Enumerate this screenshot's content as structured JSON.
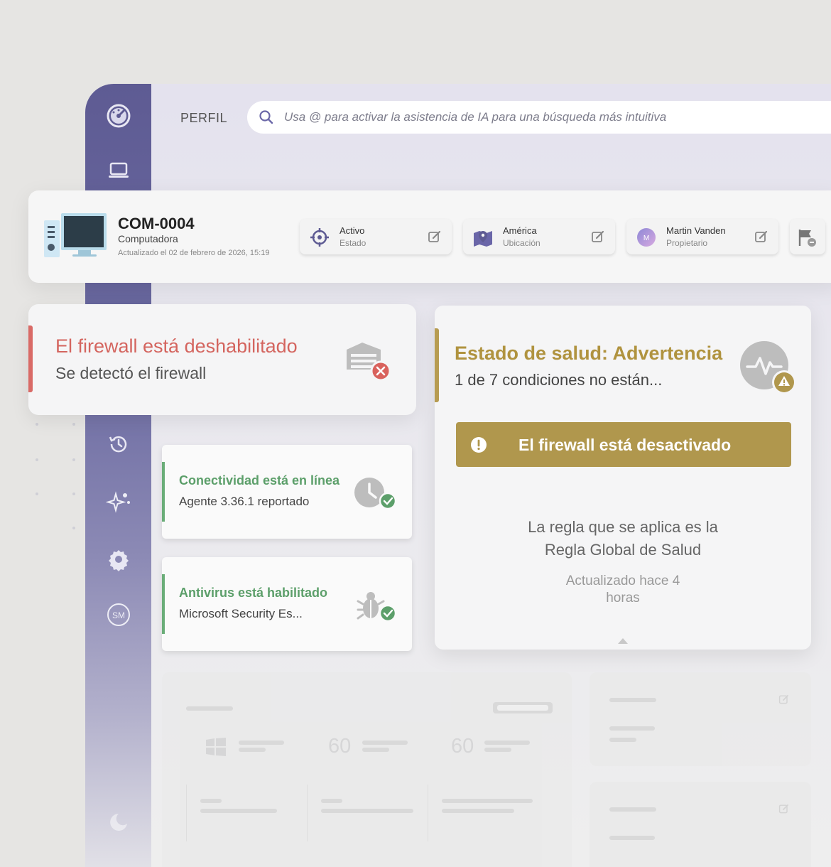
{
  "header": {
    "label": "PERFIL",
    "search_placeholder": "Usa @ para activar la asistencia de IA para una búsqueda más intuitiva"
  },
  "sidebar": {
    "icons": [
      "dashboard-gauge-icon",
      "laptop-icon",
      "history-icon",
      "ai-sparkle-icon",
      "settings-gear-icon",
      "user-avatar-sm-icon"
    ],
    "avatar_initials": "SM"
  },
  "device": {
    "name": "COM-0004",
    "type": "Computadora",
    "updated": "Actualizado el 02 de febrero de 2026, 15:19",
    "pills": [
      {
        "title": "Activo",
        "sub": "Estado",
        "icon": "crosshair-icon"
      },
      {
        "title": "América",
        "sub": "Ubicación",
        "icon": "map-pin-icon"
      },
      {
        "title": "Martin Vanden",
        "sub": "Propietario",
        "icon": "owner-avatar-icon",
        "initial": "M"
      }
    ]
  },
  "firewall_card": {
    "title": "El firewall está deshabilitado",
    "sub": "Se detectó el firewall"
  },
  "connectivity_card": {
    "title": "Conectividad está en línea",
    "sub": "Agente 3.36.1 reportado"
  },
  "antivirus_card": {
    "title": "Antivirus está habilitado",
    "sub": "Microsoft Security Es..."
  },
  "health_card": {
    "title": "Estado de salud: Advertencia",
    "sub": "1 de 7 condiciones no están...",
    "banner": "El firewall está desactivado",
    "rule_line1": "La regla que se aplica es la",
    "rule_line2": "Regla Global de Salud",
    "updated_line1": "Actualizado hace 4",
    "updated_line2": "horas"
  },
  "ghost": {
    "num1": "60",
    "num2": "60"
  },
  "colors": {
    "sidebar": "#5e5b93",
    "danger": "#d4655f",
    "success": "#5c9f6a",
    "warning": "#b0974d"
  }
}
